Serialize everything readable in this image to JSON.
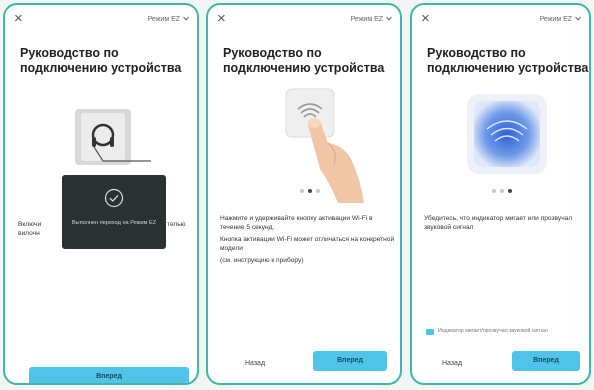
{
  "screens": [
    {
      "close_icon": "×",
      "mode_label": "Режим EZ",
      "title": "Руководство по подключению устройства",
      "body_left": "Включи",
      "body_left2": "вилочн",
      "body_right": "телью",
      "overlay": {
        "text": "Выполнен переход на Режим EZ"
      },
      "next_button": "Вперед"
    },
    {
      "close_icon": "×",
      "mode_label": "Режим EZ",
      "title": "Руководство по подключению устройства",
      "instructions": [
        "Нажмите и удерживайте кнопку активации Wi-Fi в течение 5 секунд.",
        "Кнопка активации Wi-Fi может отличаться на конкретной модели",
        "(см. инструкцию к прибору)"
      ],
      "back_button": "Назад",
      "next_button": "Вперед"
    },
    {
      "close_icon": "×",
      "mode_label": "Режим EZ",
      "title": "Руководство по подключению устройства",
      "instructions": [
        "Убедитесь, что индикатор мигает или прозвучал звуковой сигнал"
      ],
      "checkbox_label": "Индикатор мигает/прозвучал звуковой сигнал",
      "back_button": "Назад",
      "next_button": "Вперед"
    }
  ],
  "icons": {
    "close": "close-icon",
    "wifi": "wifi-icon",
    "check": "check-circle-icon",
    "dropdown": "chevron-down-icon"
  },
  "colors": {
    "accent": "#4fc3e8",
    "frame": "#3fb6a6",
    "overlay_bg": "#2b3133"
  }
}
